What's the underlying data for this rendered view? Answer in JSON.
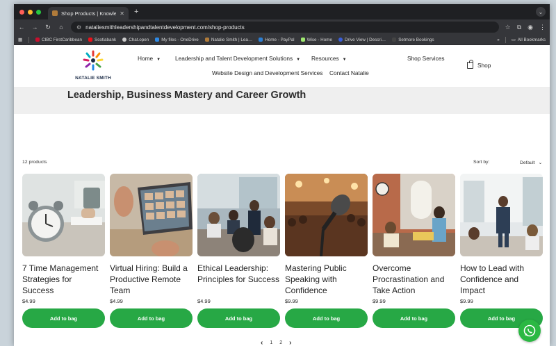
{
  "browser": {
    "tab_title": "Shop Products | Knowledge …",
    "new_tab": "+",
    "url": "nataliesmithleadershipandtalentdevelopment.com/shop-products",
    "bookmarks": [
      {
        "label": "CIBC FirstCaribbean",
        "color": "#c8102e"
      },
      {
        "label": "Scotiabank",
        "color": "#ec111a"
      },
      {
        "label": "Chat.open",
        "color": "#cccccc"
      },
      {
        "label": "My files - OneDrive",
        "color": "#2f8ae5"
      },
      {
        "label": "Natalie Smith | Lea…",
        "color": "#b07b3a"
      },
      {
        "label": "Home - PayPal",
        "color": "#2d7fd3"
      },
      {
        "label": "Wise - Home",
        "color": "#9fe870"
      },
      {
        "label": "Drive View | Descri…",
        "color": "#3b5fd9"
      },
      {
        "label": "Setmore Bookings",
        "color": "#444444"
      }
    ],
    "bookmarks_more": "»",
    "all_bookmarks": "All Bookmarks"
  },
  "site": {
    "logo_text": "NATALIE SMITH",
    "nav": {
      "home": "Home",
      "leadership": "Leadership and Talent Development Solutions",
      "resources": "Resources",
      "shop_services": "Shop Services",
      "web_design": "Website Design and Development Services",
      "contact": "Contact Natalie"
    },
    "shop_label": "Shop"
  },
  "hero": {
    "title": "Leadership, Business Mastery and Career Growth"
  },
  "toolbar": {
    "count": "12 products",
    "sort_label": "Sort by:",
    "sort_value": "Default"
  },
  "products": [
    {
      "title": "7 Time Management Strategies for Success",
      "price": "$4.99",
      "button": "Add to bag",
      "image": "alarm-clock-desk"
    },
    {
      "title": "Virtual Hiring: Build a Productive Remote Team",
      "price": "$4.99",
      "button": "Add to bag",
      "image": "video-call-laptop"
    },
    {
      "title": "Ethical Leadership: Principles for Success",
      "price": "$4.99",
      "button": "Add to bag",
      "image": "boardroom-meeting"
    },
    {
      "title": "Mastering Public Speaking with Confidence",
      "price": "$9.99",
      "button": "Add to bag",
      "image": "microphone-audience"
    },
    {
      "title": "Overcome Procrastination and Take Action",
      "price": "$9.99",
      "button": "Add to bag",
      "image": "office-coworkers"
    },
    {
      "title": "How to Lead with Confidence and Impact",
      "price": "$9.99",
      "button": "Add to bag",
      "image": "leader-presenting"
    }
  ],
  "pagination": {
    "prev": "‹",
    "pages": [
      "1",
      "2"
    ],
    "next": "›"
  },
  "colors": {
    "accent_green": "#27a845",
    "whatsapp": "#2bb843"
  }
}
